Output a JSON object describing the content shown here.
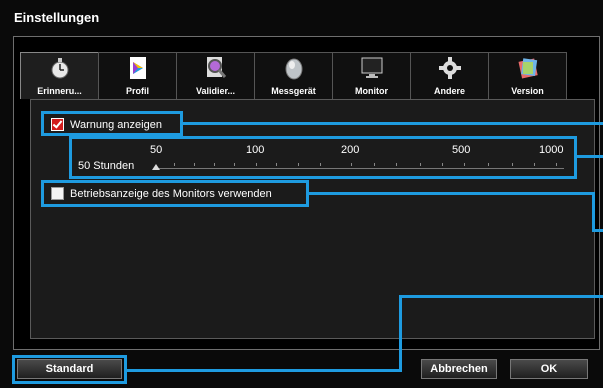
{
  "window": {
    "title": "Einstellungen"
  },
  "tabs": [
    {
      "label": "Erinneru...",
      "icon": "stopwatch-icon",
      "active": true
    },
    {
      "label": "Profil",
      "icon": "profile-document-icon",
      "active": false
    },
    {
      "label": "Validier...",
      "icon": "validation-magnifier-icon",
      "active": false
    },
    {
      "label": "Messgerät",
      "icon": "measurement-device-icon",
      "active": false
    },
    {
      "label": "Monitor",
      "icon": "monitor-icon",
      "active": false
    },
    {
      "label": "Andere",
      "icon": "gear-icon",
      "active": false
    },
    {
      "label": "Version",
      "icon": "version-icon",
      "active": false
    }
  ],
  "settings": {
    "warning_label": "Warnung anzeigen",
    "warning_checked": true,
    "status_label": "Betriebsanzeige des Monitors verwenden",
    "status_checked": false
  },
  "slider": {
    "current_label": "50 Stunden",
    "scale": [
      "50",
      "100",
      "200",
      "500",
      "1000"
    ],
    "value": 50
  },
  "buttons": {
    "standard": "Standard",
    "cancel": "Abbrechen",
    "ok": "OK"
  },
  "colors": {
    "highlight": "#1e9be0",
    "check_red": "#d21e1e"
  }
}
